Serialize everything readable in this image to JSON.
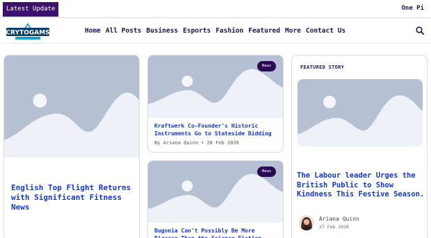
{
  "topbar": {
    "latest_label": "Latest Update",
    "ticker_text": "One Pi"
  },
  "header": {
    "logo_text": "CRYTOGAMS",
    "nav": [
      "Home",
      "All Posts",
      "Business",
      "Esports",
      "Fashion",
      "Featured",
      "More",
      "Contact Us"
    ]
  },
  "hero": {
    "title": "English Top Flight Returns with Significant Fitness News"
  },
  "mid_cards": [
    {
      "badge": "News",
      "title": "Kraftwerk Co-Founder's Historic Instruments Go to Stateside Bidding",
      "author": "By Ariana Quinn",
      "date": "28 Feb 2026"
    },
    {
      "badge": "News",
      "title": "Bugonia Can't Possibly Be More Bizarre Than the Science Fiction"
    }
  ],
  "featured": {
    "heading": "FEATURED STORY",
    "title": "The Labour leader Urges the British Public to Show Kindness This Festive Season.",
    "author": "Ariana Quinn",
    "date": "27 Feb 2026"
  },
  "colors": {
    "brand": "#3a1070",
    "link": "#1238d8",
    "nav": "#1d1450",
    "placeholder": "#b5c0d3"
  }
}
